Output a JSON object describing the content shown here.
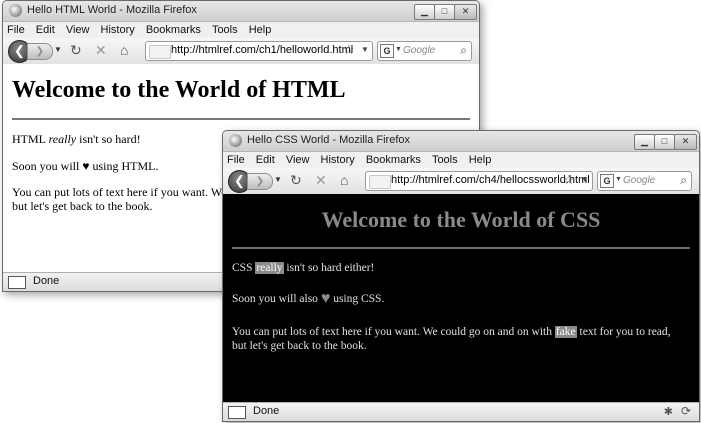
{
  "back_window": {
    "title": "Hello HTML World - Mozilla Firefox",
    "menu": [
      "File",
      "Edit",
      "View",
      "History",
      "Bookmarks",
      "Tools",
      "Help"
    ],
    "url": "http://htmlref.com/ch1/helloworld.html",
    "search_placeholder": "Google",
    "page": {
      "heading": "Welcome to the World of HTML",
      "p1_before": "HTML ",
      "p1_em": "really",
      "p1_after": " isn't so hard!",
      "p2_before": "Soon you will ",
      "p2_heart": "♥",
      "p2_after": " using HTML.",
      "p3": "You can put lots of text here if you want. We could go on and on with fake text for you to read, but let's get back to the book."
    },
    "status": "Done"
  },
  "front_window": {
    "title": "Hello CSS World - Mozilla Firefox",
    "menu": [
      "File",
      "Edit",
      "View",
      "History",
      "Bookmarks",
      "Tools",
      "Help"
    ],
    "url": "http://htmlref.com/ch4/hellocssworld.html",
    "search_placeholder": "Google",
    "page": {
      "heading": "Welcome to the World of CSS",
      "p1_before": "CSS ",
      "p1_hl": "really",
      "p1_after": " isn't so hard either!",
      "p2_before": "Soon you will also ",
      "p2_heart": "♥",
      "p2_after": " using CSS.",
      "p3_before": "You can put lots of text here if you want. We could go on and on with ",
      "p3_hl": "fake",
      "p3_after": " text for you to read, but let's get back to the book."
    },
    "status": "Done"
  },
  "icons": {
    "back": "back-arrow-icon",
    "forward": "forward-arrow-icon",
    "reload": "reload-icon",
    "stop": "stop-icon",
    "home": "home-icon",
    "bookmark_star": "star-icon",
    "search_engine": "google-icon",
    "search": "magnifier-icon"
  }
}
